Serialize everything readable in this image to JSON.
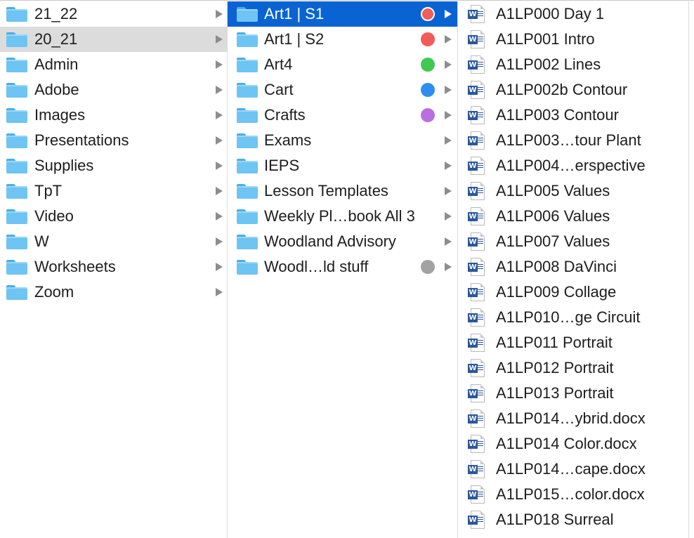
{
  "columns": {
    "col1": [
      {
        "label": "21_22",
        "state": "none"
      },
      {
        "label": "20_21",
        "state": "gray"
      },
      {
        "label": "Admin",
        "state": "none"
      },
      {
        "label": "Adobe",
        "state": "none"
      },
      {
        "label": "Images",
        "state": "none"
      },
      {
        "label": "Presentations",
        "state": "none"
      },
      {
        "label": "Supplies",
        "state": "none"
      },
      {
        "label": "TpT",
        "state": "none"
      },
      {
        "label": "Video",
        "state": "none"
      },
      {
        "label": "W",
        "state": "none"
      },
      {
        "label": "Worksheets",
        "state": "none"
      },
      {
        "label": "Zoom",
        "state": "none"
      }
    ],
    "col2": [
      {
        "label": "Art1 | S1",
        "tag": "#f25b57",
        "state": "blue"
      },
      {
        "label": "Art1 | S2",
        "tag": "#f25b57",
        "state": "none"
      },
      {
        "label": "Art4",
        "tag": "#3ec950",
        "state": "none"
      },
      {
        "label": "Cart",
        "tag": "#2e8ef0",
        "state": "none"
      },
      {
        "label": "Crafts",
        "tag": "#b96fe0",
        "state": "none"
      },
      {
        "label": "Exams",
        "tag": null,
        "state": "none"
      },
      {
        "label": "IEPS",
        "tag": null,
        "state": "none"
      },
      {
        "label": "Lesson Templates",
        "tag": null,
        "state": "none"
      },
      {
        "label": "Weekly Pl…book All 3",
        "tag": null,
        "state": "none"
      },
      {
        "label": "Woodland Advisory",
        "tag": null,
        "state": "none"
      },
      {
        "label": "Woodl…ld stuff",
        "tag": "#a2a2a2",
        "state": "none"
      }
    ],
    "col3": [
      "A1LP000 Day 1",
      "A1LP001 Intro",
      "A1LP002 Lines",
      "A1LP002b Contour",
      "A1LP003 Contour",
      "A1LP003…tour Plant",
      "A1LP004…erspective",
      "A1LP005 Values",
      "A1LP006 Values",
      "A1LP007 Values",
      "A1LP008 DaVinci",
      "A1LP009 Collage",
      "A1LP010…ge Circuit",
      "A1LP011 Portrait",
      "A1LP012 Portrait",
      "A1LP013 Portrait",
      "A1LP014…ybrid.docx",
      "A1LP014 Color.docx",
      "A1LP014…cape.docx",
      "A1LP015…color.docx",
      "A1LP018 Surreal"
    ]
  },
  "icons": {
    "folder": "folder-icon",
    "document": "word-document-icon",
    "chevron": "chevron-right-icon",
    "word_badge": "W"
  },
  "colors": {
    "selection_active": "#0a63d3",
    "selection_inactive": "#dcdcdc"
  }
}
